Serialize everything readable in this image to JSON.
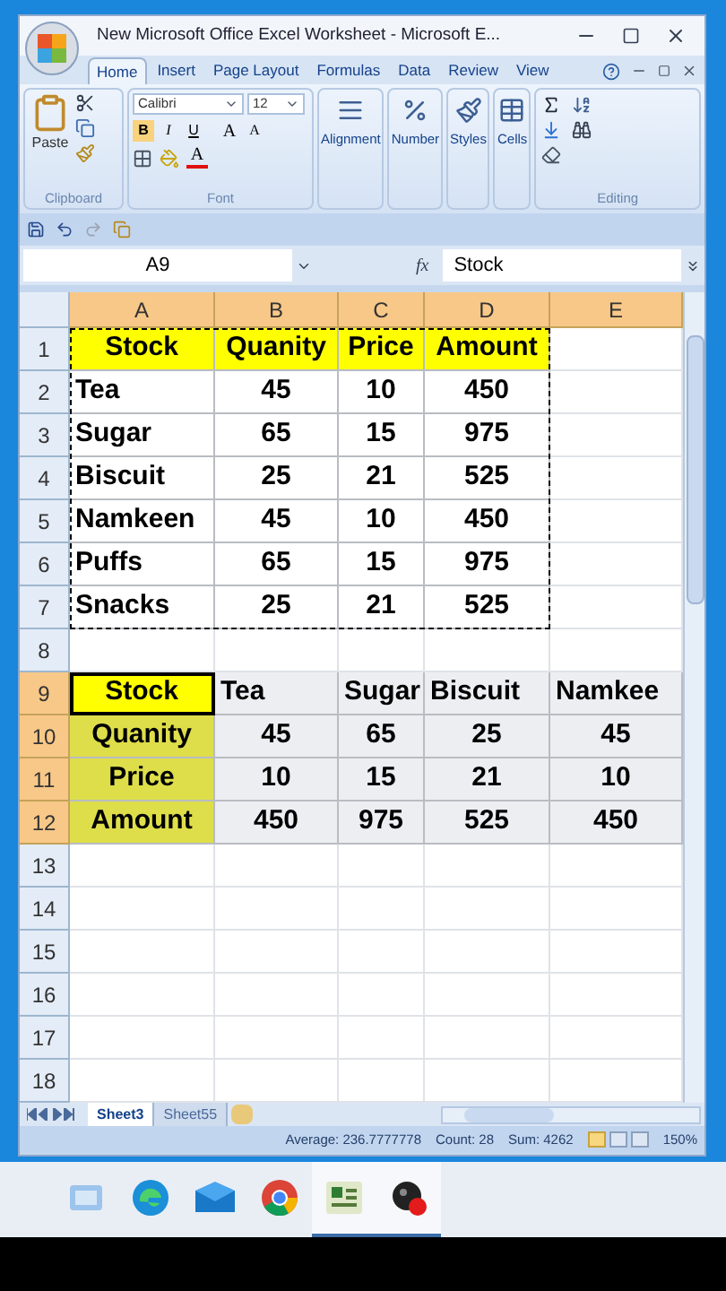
{
  "window": {
    "title": "New Microsoft Office Excel Worksheet - Microsoft E..."
  },
  "ribbon_tabs": [
    {
      "label": "Home",
      "selected": true
    },
    {
      "label": "Insert",
      "selected": false
    },
    {
      "label": "Page Layout",
      "selected": false
    },
    {
      "label": "Formulas",
      "selected": false
    },
    {
      "label": "Data",
      "selected": false
    },
    {
      "label": "Review",
      "selected": false
    },
    {
      "label": "View",
      "selected": false
    }
  ],
  "ribbon": {
    "paste_label": "Paste",
    "font_name": "Calibri",
    "font_size": "12",
    "style_buttons": [
      "B",
      "I",
      "U"
    ],
    "size_buttons": [
      "A",
      "A"
    ],
    "font_color_button": "A",
    "big_buttons": [
      "Alignment",
      "Number",
      "Styles",
      "Cells"
    ],
    "group_labels": [
      "Clipboard",
      "Font",
      "Editing"
    ]
  },
  "formula_bar": {
    "name_box": "A9",
    "fx": "fx",
    "value": "Stock"
  },
  "columns": [
    {
      "label": "A",
      "selected": true
    },
    {
      "label": "B",
      "selected": true
    },
    {
      "label": "C",
      "selected": true
    },
    {
      "label": "D",
      "selected": true
    },
    {
      "label": "E",
      "selected": true
    }
  ],
  "rows": [
    {
      "label": "1",
      "selected": false,
      "cells": [
        {
          "kind": "header",
          "text": "Stock"
        },
        {
          "kind": "header",
          "text": "Quanity"
        },
        {
          "kind": "header",
          "text": "Price"
        },
        {
          "kind": "header",
          "text": "Amount"
        }
      ]
    },
    {
      "label": "2",
      "selected": false,
      "cells": [
        {
          "kind": "label",
          "text": "Tea"
        },
        {
          "kind": "number",
          "text": "45"
        },
        {
          "kind": "number",
          "text": "10"
        },
        {
          "kind": "number",
          "text": "450"
        }
      ]
    },
    {
      "label": "3",
      "selected": false,
      "cells": [
        {
          "kind": "label",
          "text": "Sugar"
        },
        {
          "kind": "number",
          "text": "65"
        },
        {
          "kind": "number",
          "text": "15"
        },
        {
          "kind": "number",
          "text": "975"
        }
      ]
    },
    {
      "label": "4",
      "selected": false,
      "cells": [
        {
          "kind": "label",
          "text": "Biscuit"
        },
        {
          "kind": "number",
          "text": "25"
        },
        {
          "kind": "number",
          "text": "21"
        },
        {
          "kind": "number",
          "text": "525"
        }
      ]
    },
    {
      "label": "5",
      "selected": false,
      "cells": [
        {
          "kind": "label",
          "text": "Namkeen"
        },
        {
          "kind": "number",
          "text": "45"
        },
        {
          "kind": "number",
          "text": "10"
        },
        {
          "kind": "number",
          "text": "450"
        }
      ]
    },
    {
      "label": "6",
      "selected": false,
      "cells": [
        {
          "kind": "label",
          "text": "Puffs"
        },
        {
          "kind": "number",
          "text": "65"
        },
        {
          "kind": "number",
          "text": "15"
        },
        {
          "kind": "number",
          "text": "975"
        }
      ]
    },
    {
      "label": "7",
      "selected": false,
      "cells": [
        {
          "kind": "label",
          "text": "Snacks"
        },
        {
          "kind": "number",
          "text": "25"
        },
        {
          "kind": "number",
          "text": "21"
        },
        {
          "kind": "number",
          "text": "525"
        }
      ]
    },
    {
      "label": "8",
      "selected": false
    },
    {
      "label": "9",
      "selected": true,
      "cells": [
        {
          "kind": "header",
          "text": "Stock",
          "active": true
        },
        {
          "kind": "label",
          "text": "Tea"
        },
        {
          "kind": "label",
          "text": "Sugar"
        },
        {
          "kind": "label",
          "text": "Biscuit"
        },
        {
          "kind": "label",
          "text": "Namkee"
        }
      ]
    },
    {
      "label": "10",
      "selected": true,
      "cells": [
        {
          "kind": "header",
          "text": "Quanity"
        },
        {
          "kind": "number",
          "text": "45"
        },
        {
          "kind": "number",
          "text": "65"
        },
        {
          "kind": "number",
          "text": "25"
        },
        {
          "kind": "number",
          "text": "45"
        }
      ]
    },
    {
      "label": "11",
      "selected": true,
      "cells": [
        {
          "kind": "header",
          "text": "Price"
        },
        {
          "kind": "number",
          "text": "10"
        },
        {
          "kind": "number",
          "text": "15"
        },
        {
          "kind": "number",
          "text": "21"
        },
        {
          "kind": "number",
          "text": "10"
        }
      ]
    },
    {
      "label": "12",
      "selected": true,
      "cells": [
        {
          "kind": "header",
          "text": "Amount"
        },
        {
          "kind": "number",
          "text": "450"
        },
        {
          "kind": "number",
          "text": "975"
        },
        {
          "kind": "number",
          "text": "525"
        },
        {
          "kind": "number",
          "text": "450"
        }
      ]
    },
    {
      "label": "13",
      "selected": false
    },
    {
      "label": "14",
      "selected": false
    },
    {
      "label": "15",
      "selected": false
    },
    {
      "label": "16",
      "selected": false
    },
    {
      "label": "17",
      "selected": false
    },
    {
      "label": "18",
      "selected": false
    }
  ],
  "copy_marquee": true,
  "sheet_tabs": [
    {
      "label": "Sheet3",
      "selected": true
    },
    {
      "label": "Sheet55",
      "selected": false
    }
  ],
  "status_bar": {
    "average": "Average: 236.7777778",
    "count": "Count: 28",
    "sum": "Sum: 4262",
    "zoom": "150%"
  },
  "taskbar": {
    "apps": [
      {
        "kind": "files",
        "active": false
      },
      {
        "kind": "edge",
        "active": false
      },
      {
        "kind": "mail",
        "active": false
      },
      {
        "kind": "chrome",
        "active": false
      },
      {
        "kind": "excel",
        "active": true
      },
      {
        "kind": "recorder",
        "active": true
      }
    ]
  }
}
